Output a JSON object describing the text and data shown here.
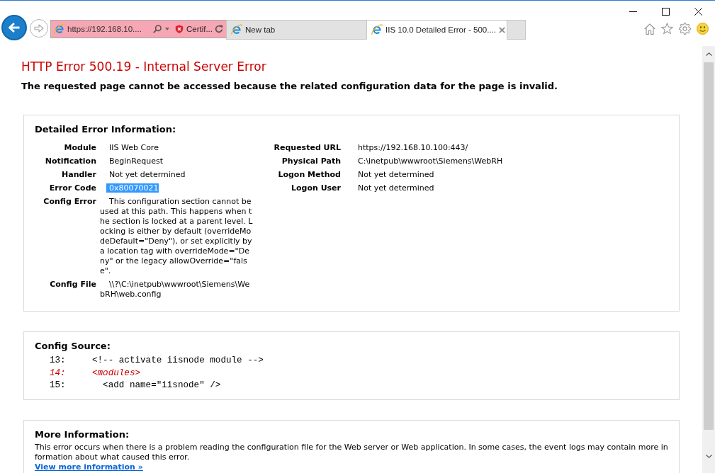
{
  "browser": {
    "address_bar": {
      "url": "https://192.168.10....",
      "certificate": "Certif..."
    },
    "tabs": [
      {
        "label": "New tab",
        "selected": false
      },
      {
        "label": "IIS 10.0 Detailed Error - 500....",
        "selected": true
      }
    ]
  },
  "page": {
    "title": "HTTP Error 500.19 - Internal Server Error",
    "subtitle": "The requested page cannot be accessed because the related configuration data for the page is invalid.",
    "detailed_error": {
      "heading": "Detailed Error Information:",
      "left_rows": [
        {
          "label": "Module",
          "value": "IIS Web Core",
          "selected": false
        },
        {
          "label": "Notification",
          "value": "BeginRequest",
          "selected": false
        },
        {
          "label": "Handler",
          "value": "Not yet determined",
          "selected": false
        },
        {
          "label": "Error Code",
          "value": "0x80070021",
          "selected": true
        },
        {
          "label": "Config Error",
          "value": "This configuration section cannot be used at this path. This happens when the section is locked at a parent level. Locking is either by default (overrideModeDefault=\"Deny\"), or set explicitly by a location tag with overrideMode=\"Deny\" or the legacy allowOverride=\"false\".",
          "selected": false
        },
        {
          "label": "Config File",
          "value": "\\\\?\\C:\\inetpub\\wwwroot\\Siemens\\WebRH\\web.config",
          "selected": false
        }
      ],
      "right_rows": [
        {
          "label": "Requested URL",
          "value": "https://192.168.10.100:443/",
          "selected": false
        },
        {
          "label": "Physical Path",
          "value": "C:\\inetpub\\wwwroot\\Siemens\\WebRH",
          "selected": false
        },
        {
          "label": "Logon Method",
          "value": "Not yet determined",
          "selected": false
        },
        {
          "label": "Logon User",
          "value": "Not yet determined",
          "selected": false
        }
      ]
    },
    "config_source": {
      "heading": "Config Source:",
      "lines": [
        {
          "number": "13:",
          "code": "<!-- activate iisnode module -->",
          "error": false
        },
        {
          "number": "14:",
          "code": "<modules>",
          "error": true
        },
        {
          "number": "15:",
          "code": "  <add name=\"iisnode\" />",
          "error": false
        }
      ]
    },
    "more_information": {
      "heading": "More Information:",
      "text": "This error occurs when there is a problem reading the configuration file for the Web server or Web application. In some cases, the event logs may contain more information about what caused this error.",
      "link": "View more information »"
    }
  }
}
